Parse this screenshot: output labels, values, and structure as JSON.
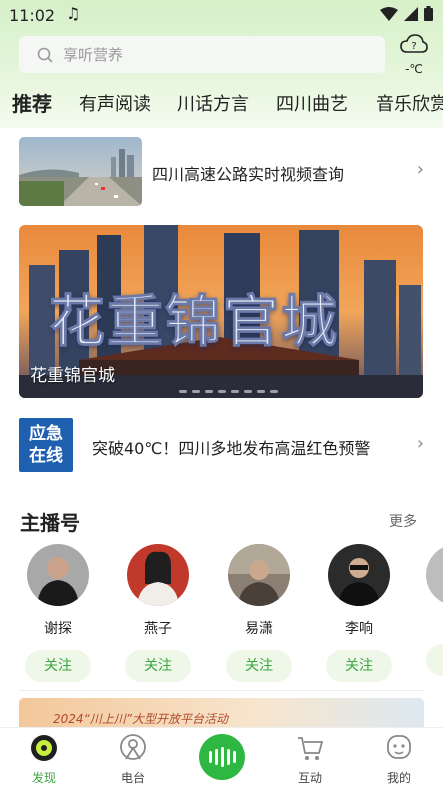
{
  "status": {
    "time": "11:02",
    "icons": [
      "music-note-icon",
      "wifi-icon",
      "signal-icon",
      "battery-icon"
    ]
  },
  "search": {
    "placeholder": "享听营养"
  },
  "weather": {
    "temp": "-℃",
    "icon": "cloud-question-icon"
  },
  "tabs": [
    {
      "label": "推荐",
      "active": true
    },
    {
      "label": "有声阅读"
    },
    {
      "label": "川话方言"
    },
    {
      "label": "四川曲艺"
    },
    {
      "label": "音乐欣赏"
    }
  ],
  "feature": {
    "title": "四川高速公路实时视频查询"
  },
  "banner": {
    "caption": "花重锦官城",
    "art_text": "花重锦官城",
    "dots": 8
  },
  "alert": {
    "badge_line1": "应急",
    "badge_line2": "在线",
    "text": "突破40℃！四川多地发布高温红色预警"
  },
  "anchors": {
    "title": "主播号",
    "more": "更多",
    "follow_label": "关注",
    "items": [
      {
        "name": "谢探"
      },
      {
        "name": "燕子"
      },
      {
        "name": "易潇"
      },
      {
        "name": "李响"
      }
    ]
  },
  "promo": {
    "text": "2024“川上川”大型开放平台活动"
  },
  "bottom_nav": [
    {
      "label": "发现",
      "icon": "discover-icon",
      "active": true
    },
    {
      "label": "电台",
      "icon": "radio-icon"
    },
    {
      "label": "",
      "icon": "audio-wave-icon"
    },
    {
      "label": "互动",
      "icon": "cart-icon"
    },
    {
      "label": "我的",
      "icon": "profile-icon"
    }
  ],
  "colors": {
    "accent": "#2fb841",
    "header_bg": "#d6f0c8",
    "alert_badge": "#1f5fb0"
  }
}
